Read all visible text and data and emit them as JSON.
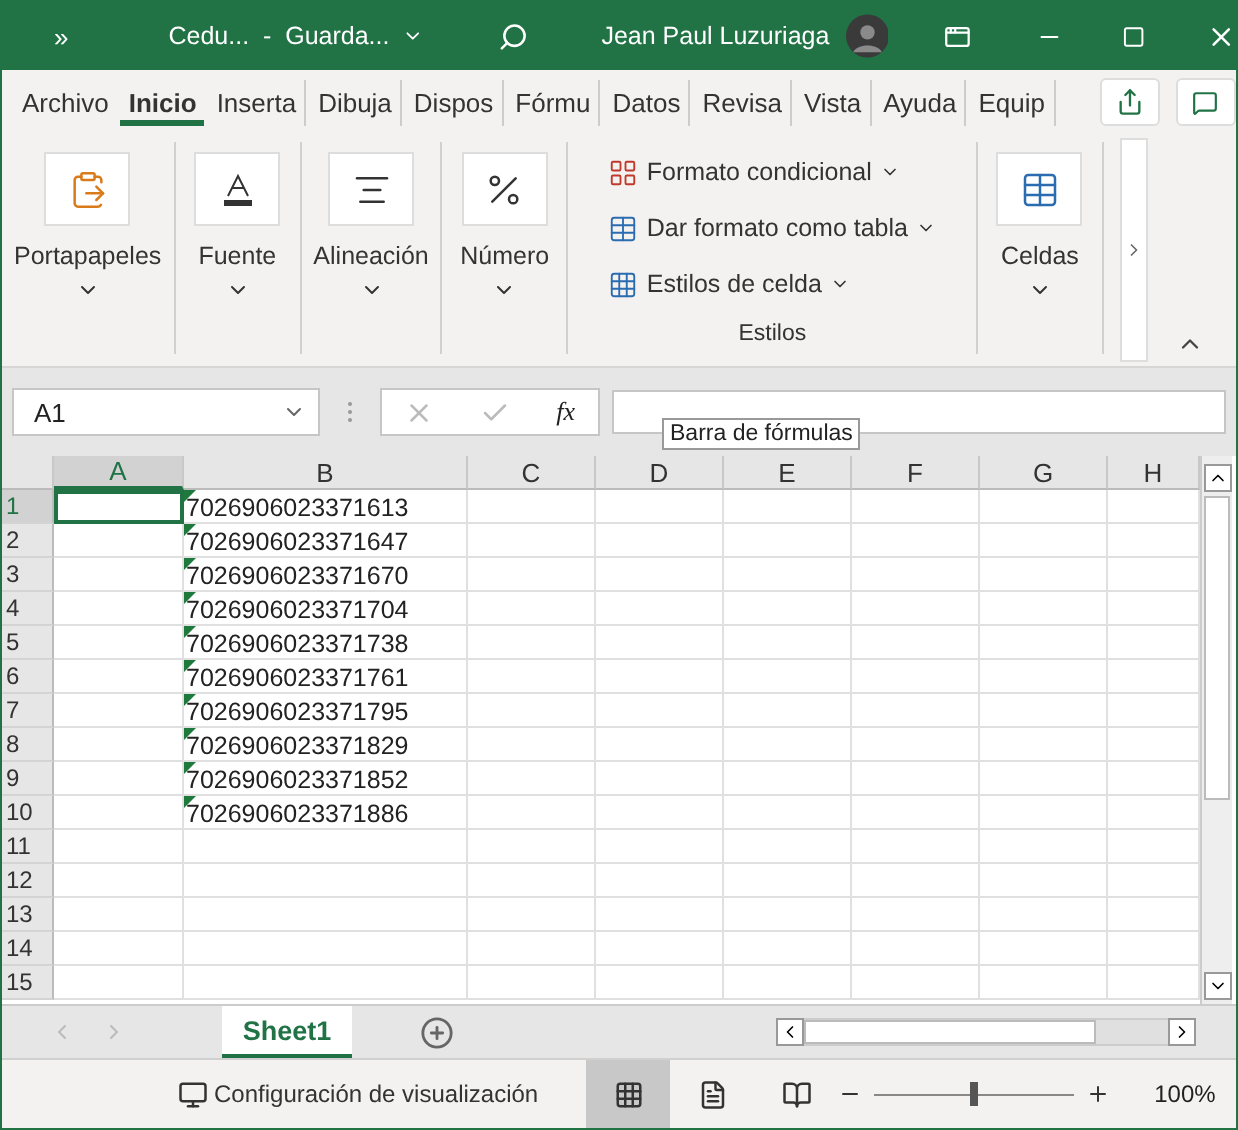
{
  "title_bar": {
    "overflow": "»",
    "document": "Cedu...  -  Guarda...",
    "user": "Jean Paul Luzuriaga"
  },
  "ribbon_tabs": [
    {
      "label": "Archivo",
      "selected": false
    },
    {
      "label": "Inicio",
      "selected": true
    },
    {
      "label": "Inserta",
      "selected": false
    },
    {
      "label": "Dibuja",
      "selected": false
    },
    {
      "label": "Dispos",
      "selected": false
    },
    {
      "label": "Fórmu",
      "selected": false
    },
    {
      "label": "Datos",
      "selected": false
    },
    {
      "label": "Revisa",
      "selected": false
    },
    {
      "label": "Vista",
      "selected": false
    },
    {
      "label": "Ayuda",
      "selected": false
    },
    {
      "label": "Equip",
      "selected": false
    }
  ],
  "ribbon_groups": [
    {
      "kind": "big",
      "label": "Portapapeles"
    },
    {
      "kind": "big",
      "label": "Fuente"
    },
    {
      "kind": "big",
      "label": "Alineación"
    },
    {
      "kind": "big",
      "label": "Número"
    },
    {
      "kind": "list",
      "label": "Estilos",
      "items": [
        {
          "label": "Formato condicional"
        },
        {
          "label": "Dar formato como tabla"
        },
        {
          "label": "Estilos de celda"
        }
      ]
    },
    {
      "kind": "big",
      "label": "Celdas"
    }
  ],
  "formula_bar": {
    "name_box": "A1",
    "fx": "fx",
    "tooltip": "Barra de fórmulas"
  },
  "grid": {
    "columns": [
      "A",
      "B",
      "C",
      "D",
      "E",
      "F",
      "G",
      "H"
    ],
    "rows": [
      {
        "number": "1",
        "b": "7026906023371613"
      },
      {
        "number": "2",
        "b": "7026906023371647"
      },
      {
        "number": "3",
        "b": "7026906023371670"
      },
      {
        "number": "4",
        "b": "7026906023371704"
      },
      {
        "number": "5",
        "b": "7026906023371738"
      },
      {
        "number": "6",
        "b": "7026906023371761"
      },
      {
        "number": "7",
        "b": "7026906023371795"
      },
      {
        "number": "8",
        "b": "7026906023371829"
      },
      {
        "number": "9",
        "b": "7026906023371852"
      },
      {
        "number": "10",
        "b": "7026906023371886"
      },
      {
        "number": "11"
      },
      {
        "number": "12"
      },
      {
        "number": "13"
      },
      {
        "number": "14"
      },
      {
        "number": "15"
      }
    ]
  },
  "sheet_tabs": [
    {
      "label": "Sheet1",
      "selected": true
    }
  ],
  "status_bar": {
    "display_settings": "Configuración de visualización",
    "zoom": {
      "level": 0.5,
      "reading": "100%"
    }
  }
}
